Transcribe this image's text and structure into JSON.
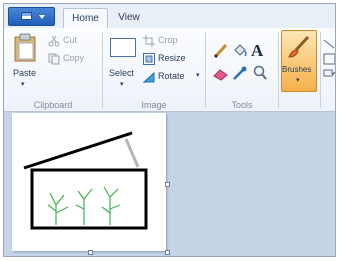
{
  "tabs": [
    {
      "label": "Home"
    },
    {
      "label": "View"
    }
  ],
  "clipboard": {
    "paste_label": "Paste",
    "cut_label": "Cut",
    "copy_label": "Copy",
    "group_label": "Clipboard"
  },
  "image": {
    "select_label": "Select",
    "crop_label": "Crop",
    "resize_label": "Resize",
    "rotate_label": "Rotate",
    "group_label": "Image"
  },
  "tools": {
    "group_label": "Tools",
    "text_tool_glyph": "A"
  },
  "brushes": {
    "label": "Brushes"
  },
  "colors": {
    "accent": "#1f5fb8",
    "active_tool": "#f6b04a",
    "drawing_stroke": "#000000",
    "plant_stroke": "#3cb44b"
  }
}
